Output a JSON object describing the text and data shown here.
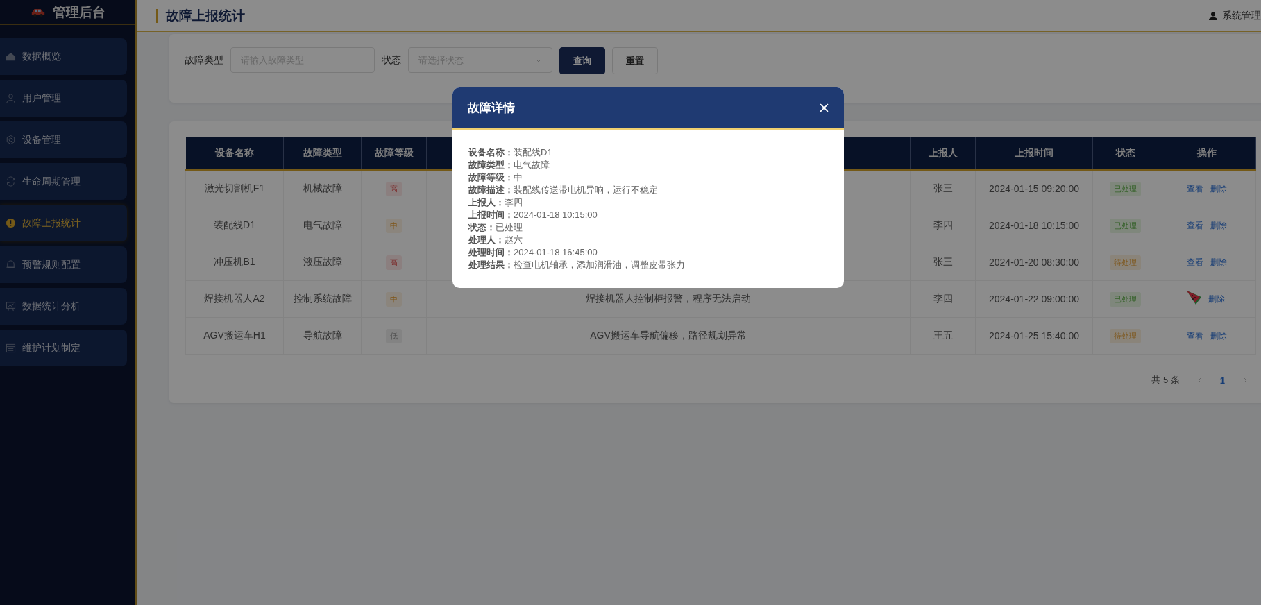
{
  "sidebar": {
    "logo": "管理后台",
    "items": [
      {
        "label": "数据概览",
        "selected": false
      },
      {
        "label": "用户管理",
        "selected": false
      },
      {
        "label": "设备管理",
        "selected": false
      },
      {
        "label": "生命周期管理",
        "selected": false
      },
      {
        "label": "故障上报统计",
        "selected": true
      },
      {
        "label": "预警规则配置",
        "selected": false
      },
      {
        "label": "数据统计分析",
        "selected": false
      },
      {
        "label": "维护计划制定",
        "selected": false
      }
    ]
  },
  "header": {
    "title": "故障上报统计",
    "user": "系统管理"
  },
  "filters": {
    "fault_type_label": "故障类型",
    "fault_type_placeholder": "请输入故障类型",
    "status_label": "状态",
    "status_placeholder": "请选择状态",
    "buttons": [
      {
        "label": "查询",
        "kind": "primary"
      },
      {
        "label": "重置",
        "kind": "default"
      }
    ]
  },
  "table": {
    "columns": [
      "设备名称",
      "故障类型",
      "故障等级",
      "",
      "上报人",
      "上报时间",
      "状态",
      "操作"
    ],
    "rows": [
      {
        "device": "激光切割机F1",
        "type": "机械故障",
        "level": {
          "text": "高",
          "kind": "high"
        },
        "description": "",
        "reporter": "张三",
        "time": "2024-01-15 09:20:00",
        "status": {
          "text": "已处理",
          "kind": "done"
        },
        "actions": [
          {
            "kind": "view",
            "label": "查看"
          },
          {
            "kind": "delete",
            "label": "删除"
          }
        ]
      },
      {
        "device": "装配线D1",
        "type": "电气故障",
        "level": {
          "text": "中",
          "kind": "medium"
        },
        "description": "",
        "reporter": "李四",
        "time": "2024-01-18 10:15:00",
        "status": {
          "text": "已处理",
          "kind": "done"
        },
        "actions": [
          {
            "kind": "view",
            "label": "查看"
          },
          {
            "kind": "delete",
            "label": "删除"
          }
        ]
      },
      {
        "device": "冲压机B1",
        "type": "液压故障",
        "level": {
          "text": "高",
          "kind": "high"
        },
        "description": "",
        "reporter": "张三",
        "time": "2024-01-20 08:30:00",
        "status": {
          "text": "待处理",
          "kind": "pending"
        },
        "actions": [
          {
            "kind": "view",
            "label": "查看"
          },
          {
            "kind": "delete",
            "label": "删除"
          }
        ]
      },
      {
        "device": "焊接机器人A2",
        "type": "控制系统故障",
        "level": {
          "text": "中",
          "kind": "medium"
        },
        "description": "焊接机器人控制柜报警，程序无法启动",
        "reporter": "李四",
        "time": "2024-01-22 09:00:00",
        "status": {
          "text": "已处理",
          "kind": "done"
        },
        "actions": [
          {
            "kind": "sticker"
          },
          {
            "kind": "delete",
            "label": "删除"
          }
        ]
      },
      {
        "device": "AGV搬运车H1",
        "type": "导航故障",
        "level": {
          "text": "低",
          "kind": "low"
        },
        "description": "AGV搬运车导航偏移，路径规划异常",
        "reporter": "王五",
        "time": "2024-01-25 15:40:00",
        "status": {
          "text": "待处理",
          "kind": "pending"
        },
        "actions": [
          {
            "kind": "view",
            "label": "查看"
          },
          {
            "kind": "delete",
            "label": "删除"
          }
        ]
      }
    ]
  },
  "pagination": {
    "total": "共 5 条",
    "pages": [
      {
        "label": "1",
        "selected": true
      }
    ]
  },
  "dialog": {
    "title": "故障详情",
    "fields": [
      {
        "label": "设备名称：",
        "value": "装配线D1"
      },
      {
        "label": "故障类型：",
        "value": "电气故障"
      },
      {
        "label": "故障等级：",
        "value": "中"
      },
      {
        "label": "故障描述：",
        "value": "装配线传送带电机异响，运行不稳定"
      },
      {
        "label": "上报人：",
        "value": "李四"
      },
      {
        "label": "上报时间：",
        "value": "2024-01-18 10:15:00"
      },
      {
        "label": "状态：",
        "value": "已处理"
      },
      {
        "label": "处理人：",
        "value": "赵六"
      },
      {
        "label": "处理时间：",
        "value": "2024-01-18 16:45:00"
      },
      {
        "label": "处理结果：",
        "value": "检查电机轴承，添加润滑油，调整皮带张力"
      }
    ]
  }
}
